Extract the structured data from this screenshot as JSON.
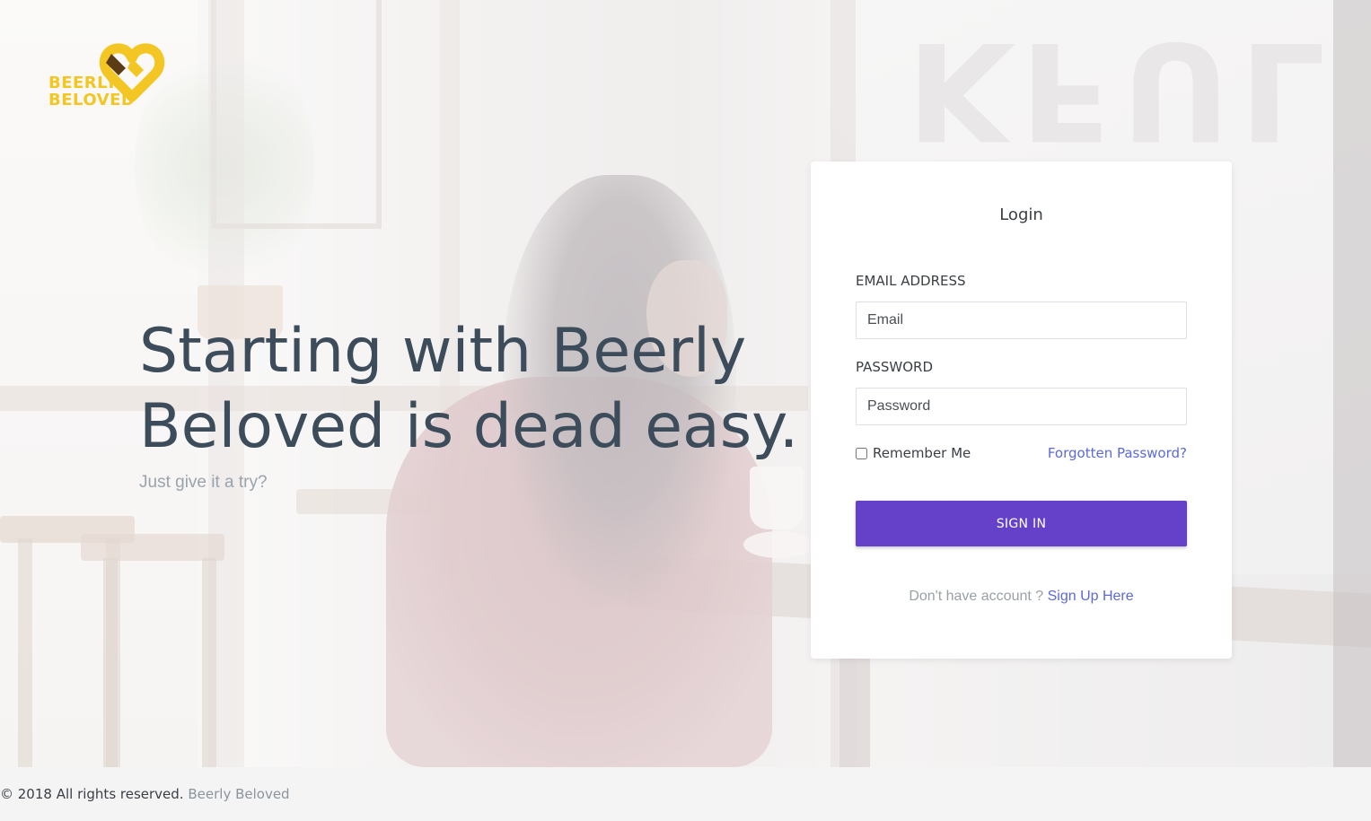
{
  "brand": {
    "logo_line1": "BEERLY",
    "logo_line2": "BELOVED",
    "logo_colors": {
      "yellow": "#f3c623",
      "brown": "#5b3b14"
    }
  },
  "hero": {
    "headline_line1": "Starting with Beerly",
    "headline_line2": "Beloved is dead easy.",
    "subline": "Just give it a try?"
  },
  "login": {
    "title": "Login",
    "email_label": "EMAIL ADDRESS",
    "email_placeholder": "Email",
    "password_label": "PASSWORD",
    "password_placeholder": "Password",
    "remember_label": "Remember Me",
    "remember_checked": false,
    "forgot_label": "Forgotten Password?",
    "signin_label": "SIGN IN",
    "no_account_text": "Don't have account ?",
    "signup_label": "Sign Up Here"
  },
  "footer": {
    "copyright": "© 2018 All rights reserved.",
    "brand_link": "Beerly Beloved"
  },
  "colors": {
    "accent": "#6441c8",
    "link": "#5b6ad8",
    "heading": "#3d4c5a"
  }
}
